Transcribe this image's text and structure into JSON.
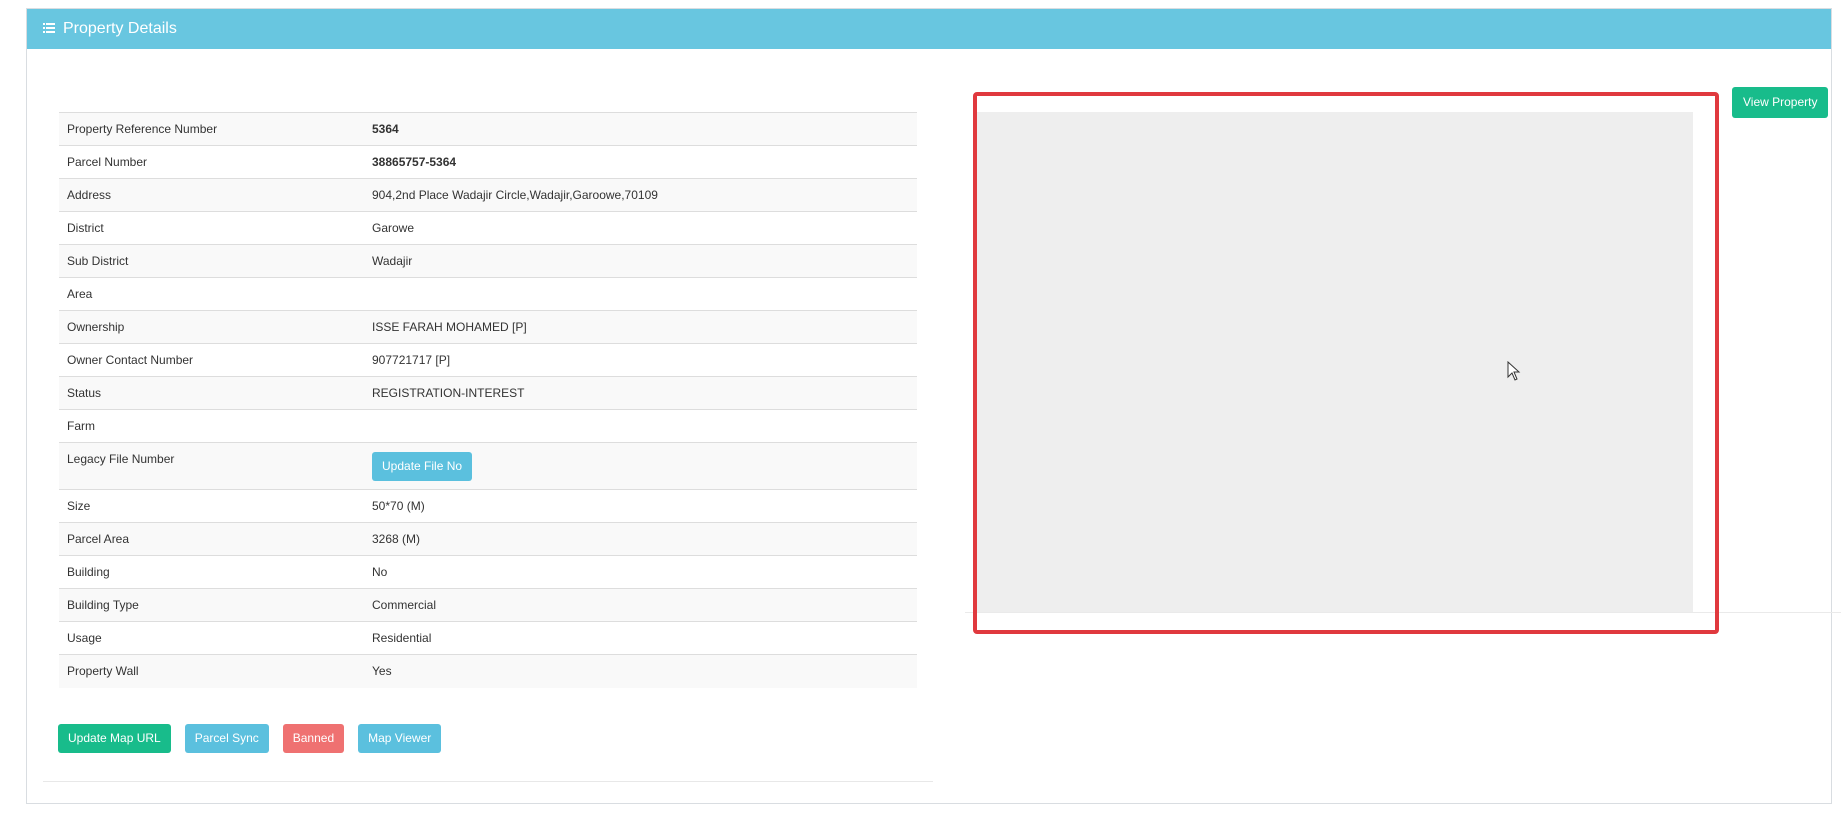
{
  "panel": {
    "title": "Property Details",
    "icon": "list-icon",
    "header_color": "#68c6e0"
  },
  "details": [
    {
      "label": "Property Reference Number",
      "value": "5364"
    },
    {
      "label": "Parcel Number",
      "value": "38865757-5364"
    },
    {
      "label": "Address",
      "value": "904,2nd Place Wadajir Circle,Wadajir,Garoowe,70109"
    },
    {
      "label": "District",
      "value": "Garowe"
    },
    {
      "label": "Sub District",
      "value": "Wadajir"
    },
    {
      "label": "Area",
      "value": ""
    },
    {
      "label": "Ownership",
      "value": "ISSE FARAH MOHAMED [P]"
    },
    {
      "label": "Owner Contact Number",
      "value": "907721717 [P]"
    },
    {
      "label": "Status",
      "value": "REGISTRATION-INTEREST"
    },
    {
      "label": "Farm",
      "value": ""
    },
    {
      "label": "Legacy File Number",
      "button": "Update File No"
    },
    {
      "label": "Size",
      "value": "50*70 (M)"
    },
    {
      "label": "Parcel Area",
      "value": "3268 (M)"
    },
    {
      "label": "Building",
      "value": "No"
    },
    {
      "label": "Building Type",
      "value": "Commercial"
    },
    {
      "label": "Usage",
      "value": "Residential"
    },
    {
      "label": "Property Wall",
      "value": "Yes"
    }
  ],
  "buttons": {
    "update_map_url": "Update Map URL",
    "parcel_sync": "Parcel Sync",
    "banned": "Banned",
    "map_viewer": "Map Viewer",
    "view_property": "View Property"
  },
  "colors": {
    "success": "#18bc8b",
    "info": "#5bc0de",
    "danger": "#ef7171",
    "highlight": "#e0393e"
  }
}
